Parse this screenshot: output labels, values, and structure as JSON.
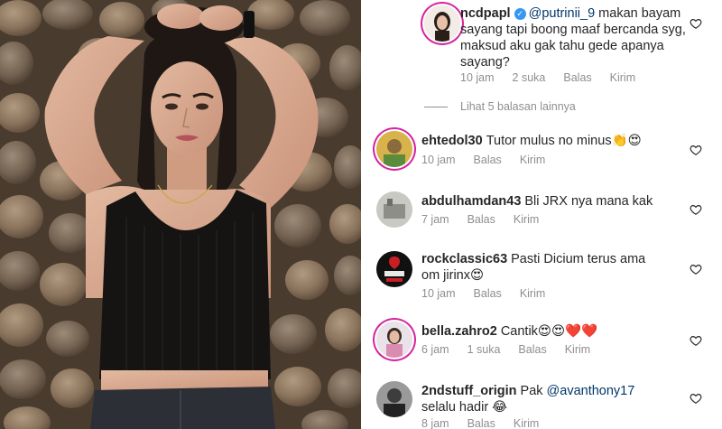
{
  "comments": [
    {
      "username": "ncdpapl",
      "verified": true,
      "mention": "@putrinii_9",
      "text": " makan bayam sayang tapi boong maaf bercanda syg, maksud aku gak tahu gede apanya sayang?",
      "time": "10 jam",
      "likes": "2 suka",
      "reply_label": "Balas",
      "send_label": "Kirim"
    },
    {
      "username": "ehtedol30",
      "text": "Tutor mulus no minus👏😍",
      "time": "10 jam",
      "reply_label": "Balas",
      "send_label": "Kirim"
    },
    {
      "username": "abdulhamdan43",
      "text": "Bli JRX nya mana kak",
      "time": "7 jam",
      "reply_label": "Balas",
      "send_label": "Kirim"
    },
    {
      "username": "rockclassic63",
      "text": "Pasti Dicium terus ama om jirinx😍",
      "time": "10 jam",
      "reply_label": "Balas",
      "send_label": "Kirim"
    },
    {
      "username": "bella.zahro2",
      "text": "Cantik😍😍❤️❤️",
      "time": "6 jam",
      "likes": "1 suka",
      "reply_label": "Balas",
      "send_label": "Kirim"
    },
    {
      "username": "2ndstuff_origin",
      "text_before": "Pak ",
      "mention": "@avanthony17",
      "text": " selalu hadir 😂",
      "time": "8 jam",
      "reply_label": "Balas",
      "send_label": "Kirim"
    }
  ],
  "view_replies_label": "Lihat 5 balasan lainnya",
  "colors": {
    "mention": "#00376b",
    "meta": "#8e8e8e",
    "verified": "#3897f0",
    "story_ring": "#d6249f"
  }
}
